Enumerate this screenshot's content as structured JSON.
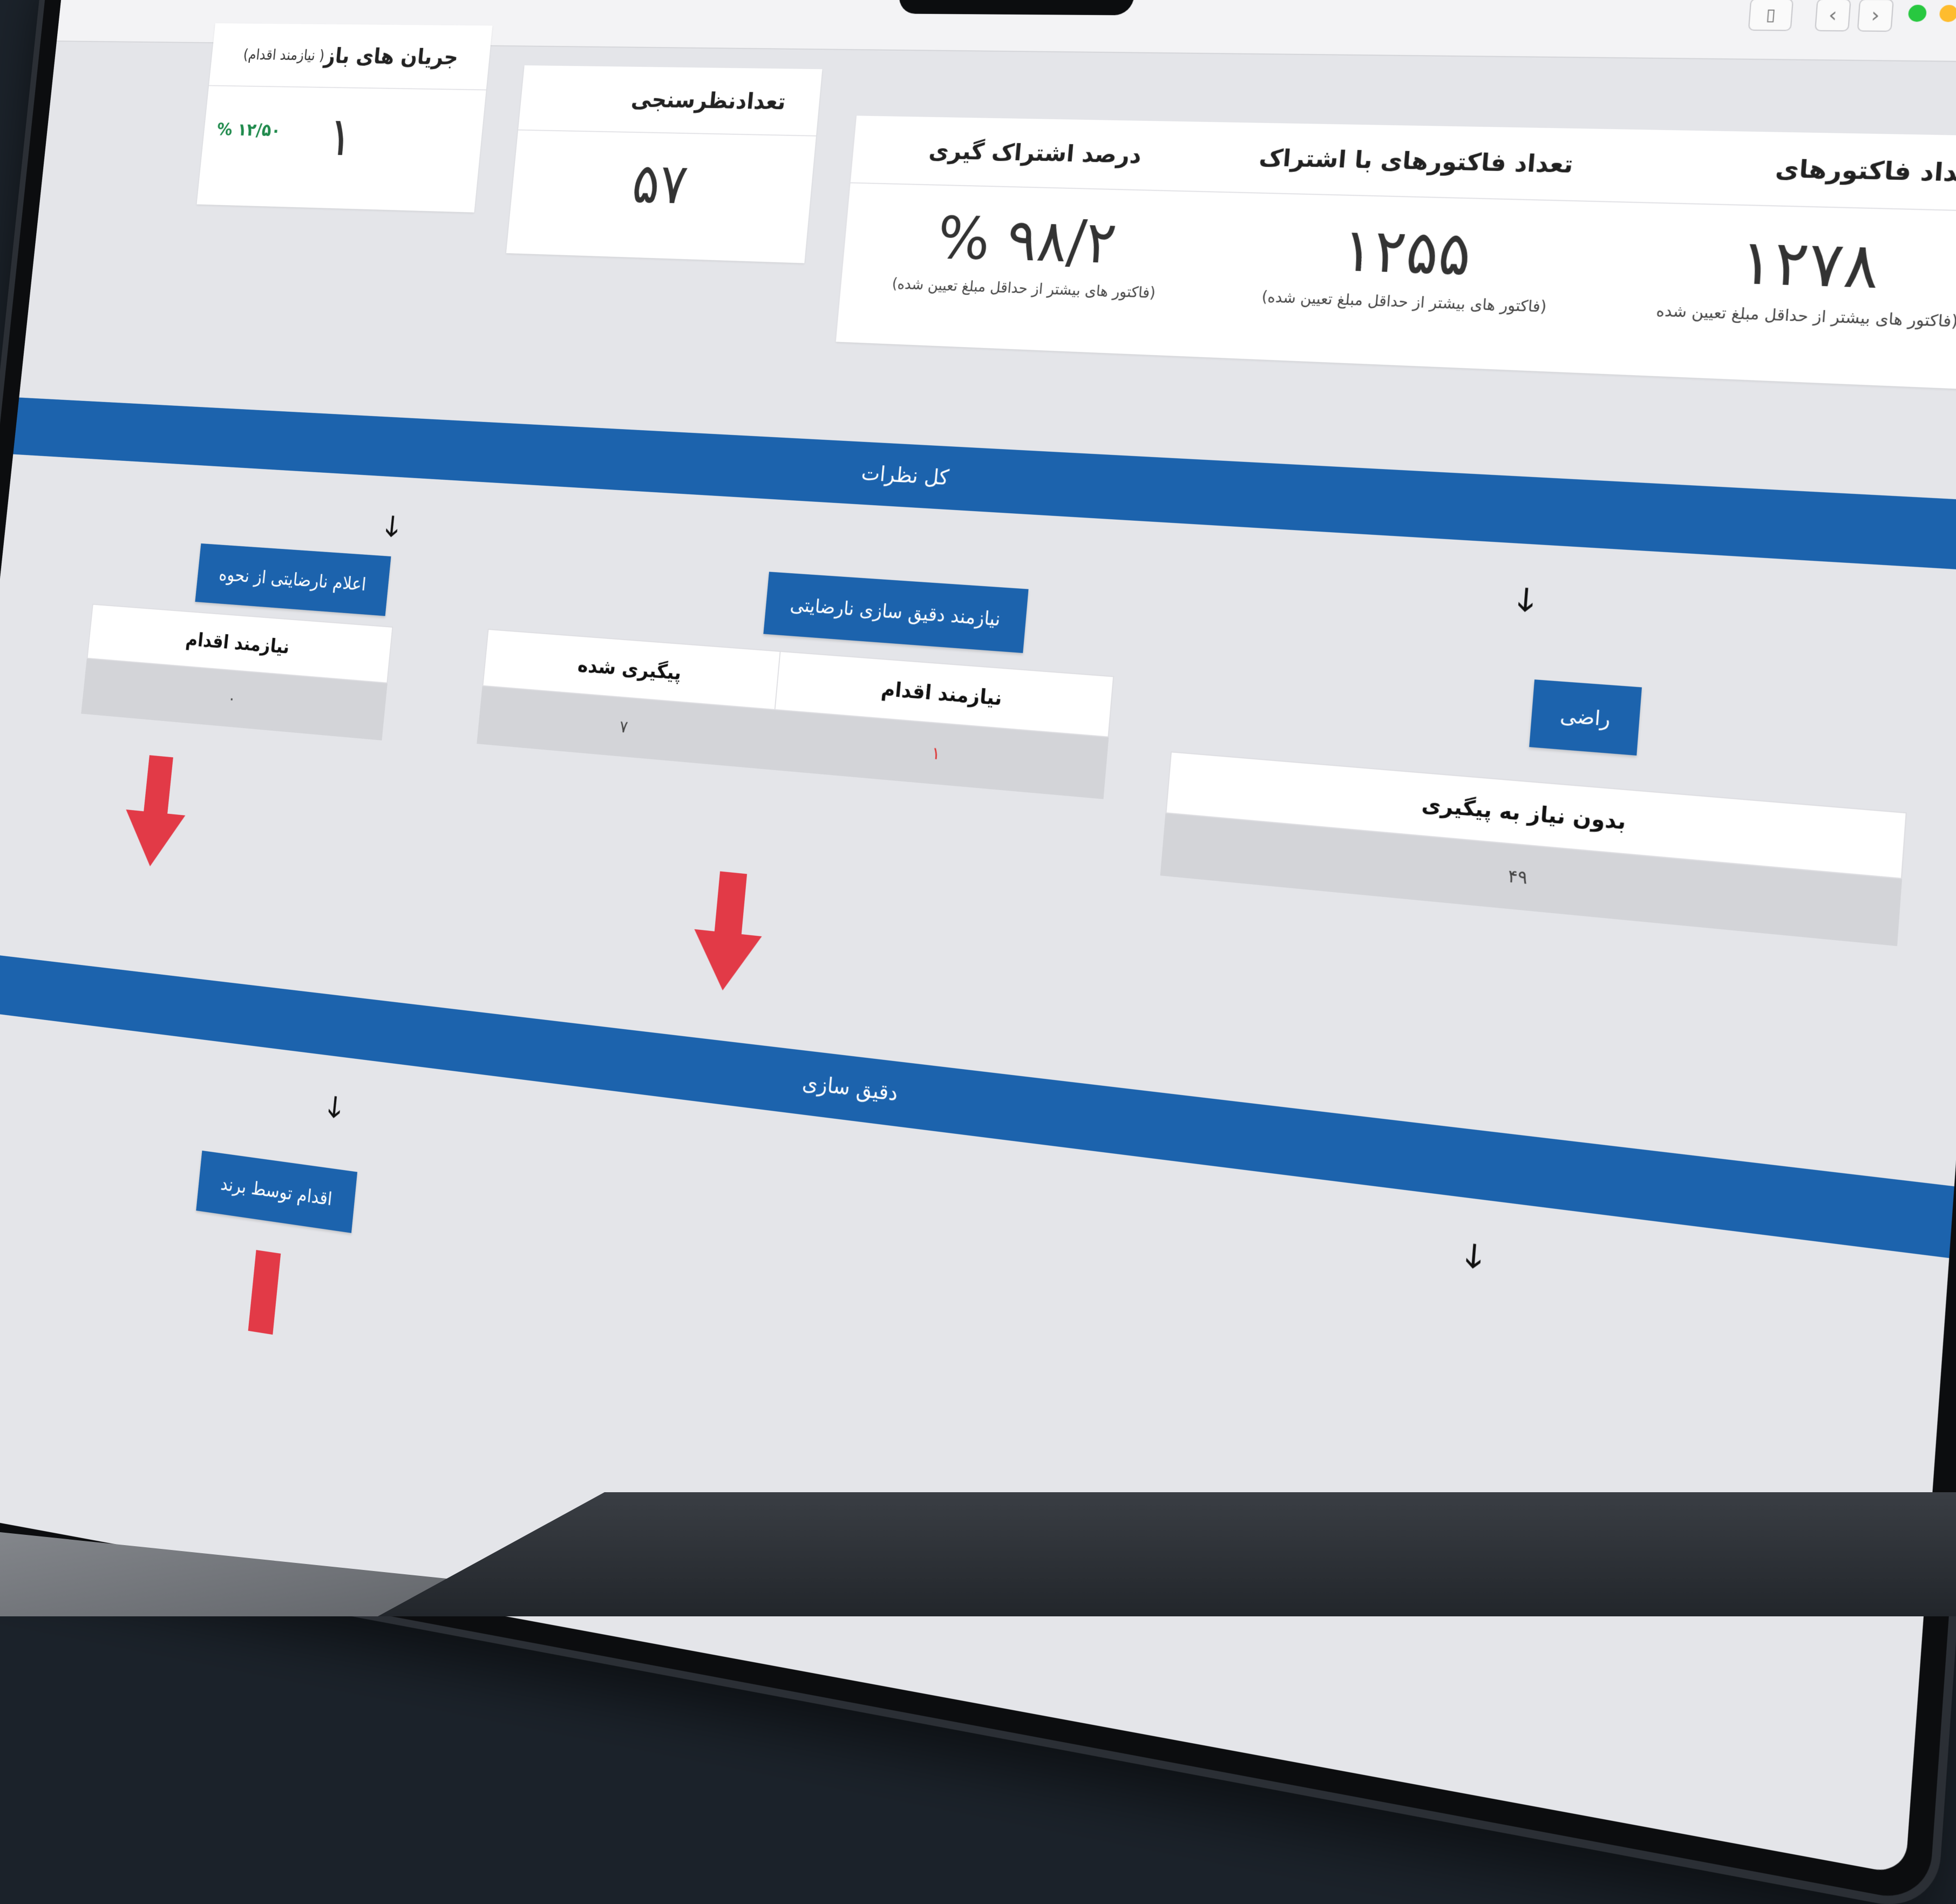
{
  "browser": {
    "traffic_lights": [
      "#ff5f57",
      "#febc2e",
      "#28c840"
    ],
    "back_glyph": "‹",
    "forward_glyph": "›",
    "sidebar_glyph": "▯"
  },
  "cards": {
    "invoices": {
      "title": "تعداد فاکتورهای",
      "value": "۱۲۷۸",
      "note": "(فاکتور های بیشتر از حداقل مبلغ تعیین شده"
    },
    "invoices_with_share": {
      "title": "تعداد فاکتورهای با اشتراک",
      "value": "۱۲۵۵",
      "note": "(فاکتور های بیشتر از حداقل مبلغ تعیین شده)"
    },
    "share_percent": {
      "title": "درصد اشتراک گیری",
      "value": "% ۹۸/۲",
      "note": "(فاکتور های بیشتر از حداقل مبلغ تعیین شده)"
    },
    "surveys": {
      "title": "تعدادنظرسنجی",
      "value": "۵۷"
    },
    "open_flows": {
      "title": "جریان های باز",
      "title_hint": "( نیازمند اقدام)",
      "value": "۱",
      "percent": "% ۱۲/۵۰"
    }
  },
  "sections": {
    "all_comments": "کل نظرات",
    "refinement": "دقیق سازی"
  },
  "buttons": {
    "satisfied": "راضی",
    "needs_refinement": "نیازمند دقیق سازی نارضایتی",
    "complaint": "اعلام نارضایتی از نحوه",
    "brand_action": "اقدام توسط برند"
  },
  "tables": {
    "satisfied": {
      "headers": [
        "بدون نیاز به پیگیری"
      ],
      "values": [
        "۴۹"
      ]
    },
    "refinement": {
      "headers": [
        "نیازمند اقدام",
        "پیگیری شده"
      ],
      "values": [
        "۱",
        "۷"
      ]
    },
    "complaint": {
      "headers": [
        "نیازمند اقدام"
      ],
      "values": [
        "۰"
      ]
    }
  },
  "arrow_glyph": "🡓"
}
